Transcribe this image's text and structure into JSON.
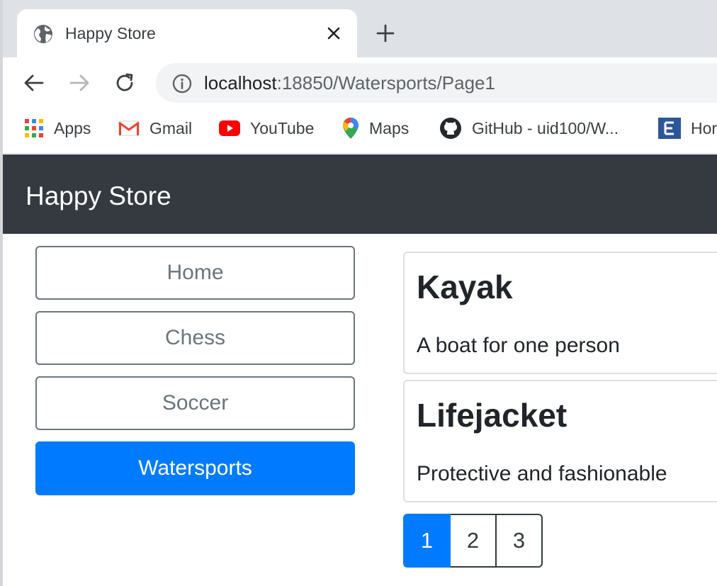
{
  "browser": {
    "tab_title": "Happy Store",
    "url_host": "localhost",
    "url_path": ":18850/Watersports/Page1",
    "bookmarks": [
      {
        "label": "Apps",
        "icon": "apps-grid-icon"
      },
      {
        "label": "Gmail",
        "icon": "gmail-icon"
      },
      {
        "label": "YouTube",
        "icon": "youtube-icon"
      },
      {
        "label": "Maps",
        "icon": "maps-pin-icon"
      },
      {
        "label": "GitHub - uid100/W...",
        "icon": "github-icon"
      },
      {
        "label": "Hor",
        "icon": "e-bookmark-icon"
      }
    ]
  },
  "navbar": {
    "brand": "Happy Store",
    "background": "#343a40"
  },
  "categories": [
    {
      "label": "Home",
      "active": false
    },
    {
      "label": "Chess",
      "active": false
    },
    {
      "label": "Soccer",
      "active": false
    },
    {
      "label": "Watersports",
      "active": true
    }
  ],
  "products": [
    {
      "name": "Kayak",
      "description": "A boat for one person"
    },
    {
      "name": "Lifejacket",
      "description": "Protective and fashionable"
    }
  ],
  "pagination": {
    "pages": [
      "1",
      "2",
      "3"
    ],
    "current": "1"
  },
  "colors": {
    "primary": "#007bff",
    "secondary": "#6c757d"
  }
}
